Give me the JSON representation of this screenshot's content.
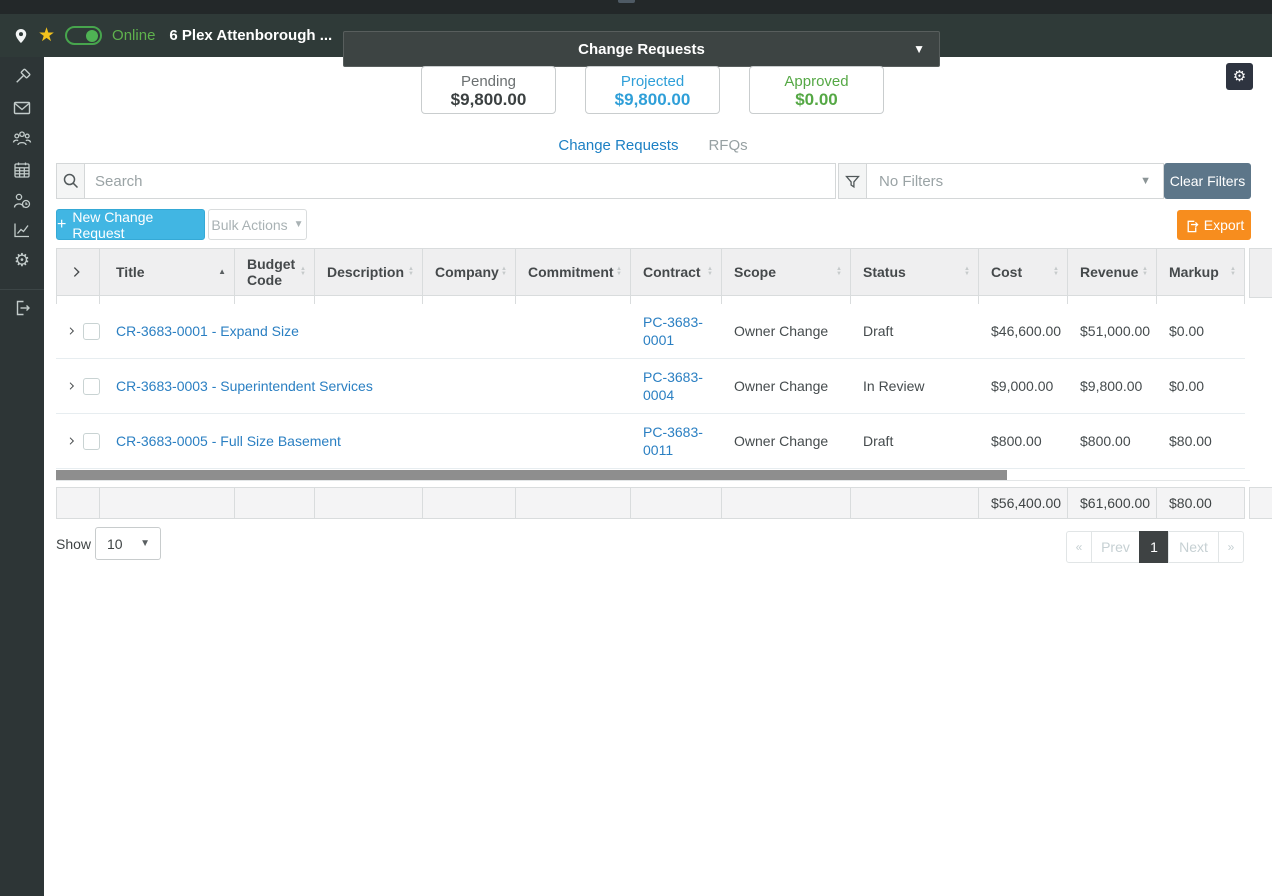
{
  "topbar": {
    "online_label": "Online",
    "online_toggle_on": true,
    "project_name": "6 Plex Attenborough ...",
    "page_selector_value": "Change Requests",
    "icons": [
      "map-pin-icon",
      "star-icon",
      "online-toggle"
    ]
  },
  "sidebar": {
    "icons": [
      "hammer-icon",
      "mail-icon",
      "contacts-icon",
      "calendar-icon",
      "time-clock-icon",
      "chart-icon",
      "gear-icon",
      "logout-icon"
    ]
  },
  "summary_cards": [
    {
      "label": "Pending",
      "value": "$9,800.00",
      "color": "#6b7071",
      "value_color": "#3b4041"
    },
    {
      "label": "Projected",
      "value": "$9,800.00",
      "color": "#2f9fd8",
      "value_color": "#2f9fd8"
    },
    {
      "label": "Approved",
      "value": "$0.00",
      "color": "#55a845",
      "value_color": "#55a845"
    }
  ],
  "tabs": [
    {
      "label": "Change Requests",
      "active": true
    },
    {
      "label": "RFQs",
      "active": false
    }
  ],
  "toolbar": {
    "search_placeholder": "Search",
    "filter_value": "No Filters",
    "clear_filters_label": "Clear Filters",
    "new_change_request_label": "New Change Request",
    "bulk_actions_label": "Bulk Actions",
    "export_label": "Export",
    "icons": [
      "search-icon",
      "funnel-icon",
      "plus-icon",
      "export-icon",
      "settings-gear-icon"
    ]
  },
  "table": {
    "columns": [
      "Title",
      "Budget Code",
      "Description",
      "Company",
      "Commitment",
      "Contract",
      "Scope",
      "Status",
      "Cost",
      "Revenue",
      "Markup"
    ],
    "sorted_column": "Title",
    "sort_direction": "asc",
    "rows": [
      {
        "title": "CR-3683-0001 - Expand Size",
        "budget_code": "",
        "description": "",
        "company": "",
        "commitment": "",
        "contract": "PC-3683-0001",
        "scope": "Owner Change",
        "status": "Draft",
        "cost": "$46,600.00",
        "revenue": "$51,000.00",
        "markup": "$0.00"
      },
      {
        "title": "CR-3683-0003 - Superintendent Services",
        "budget_code": "",
        "description": "",
        "company": "",
        "commitment": "",
        "contract": "PC-3683-0004",
        "scope": "Owner Change",
        "status": "In Review",
        "cost": "$9,000.00",
        "revenue": "$9,800.00",
        "markup": "$0.00"
      },
      {
        "title": "CR-3683-0005 - Full Size Basement",
        "budget_code": "",
        "description": "",
        "company": "",
        "commitment": "",
        "contract": "PC-3683-0011",
        "scope": "Owner Change",
        "status": "Draft",
        "cost": "$800.00",
        "revenue": "$800.00",
        "markup": "$80.00"
      }
    ],
    "totals": {
      "cost": "$56,400.00",
      "revenue": "$61,600.00",
      "markup": "$80.00"
    }
  },
  "pagination": {
    "show_label": "Show",
    "page_size": "10",
    "first_label": "«",
    "prev_label": "Prev",
    "current_page": "1",
    "next_label": "Next",
    "last_label": "»"
  }
}
